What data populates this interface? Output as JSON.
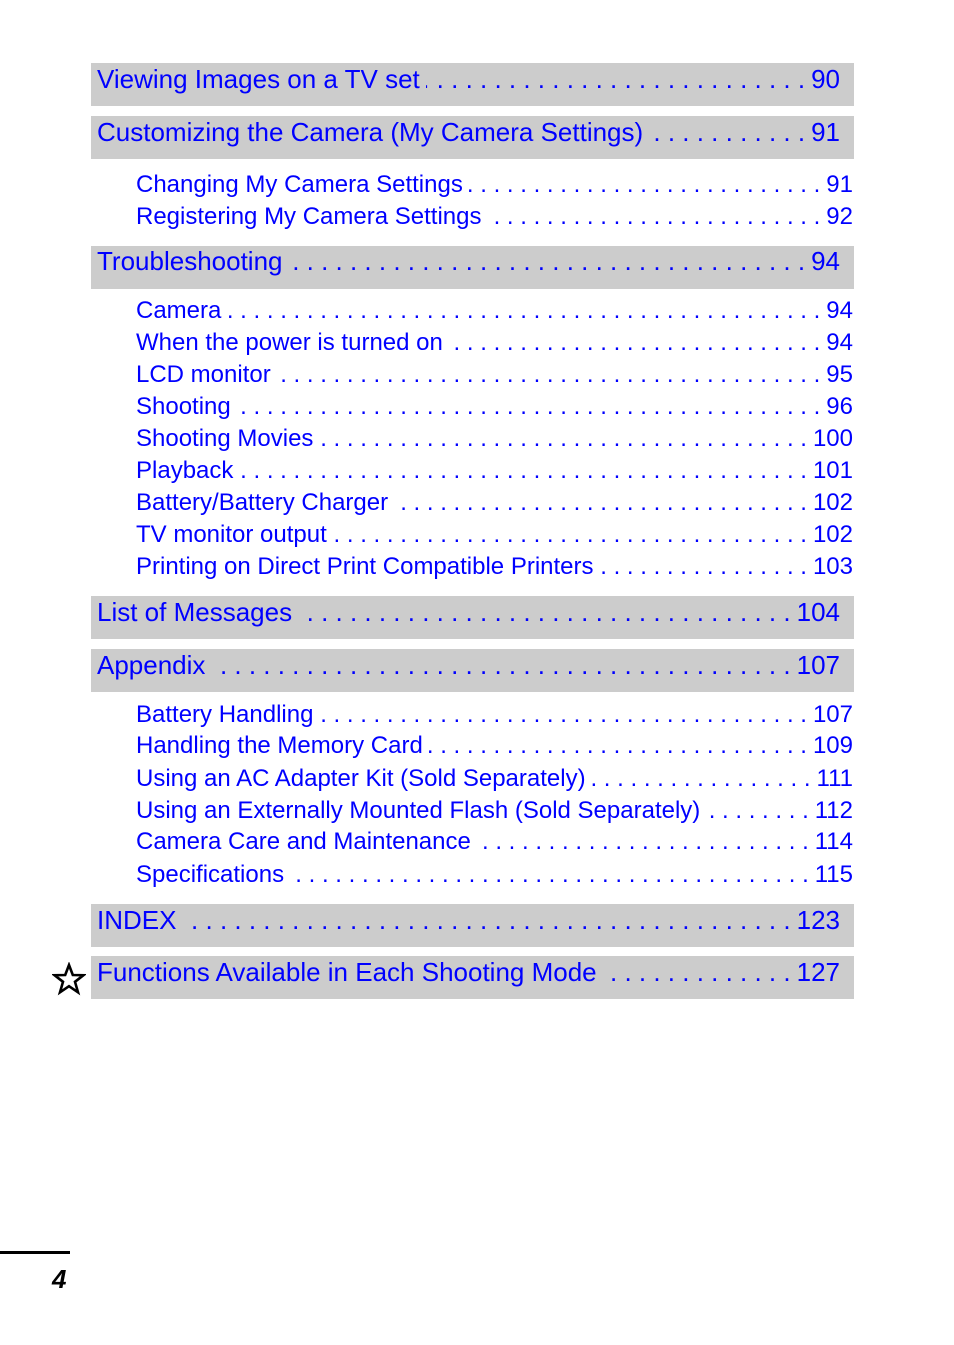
{
  "toc": [
    {
      "type": "section",
      "title": "Viewing Images on a TV set",
      "page": "90"
    },
    {
      "type": "section",
      "title": "Customizing the Camera (My Camera Settings)",
      "page": "91"
    },
    {
      "type": "sub",
      "title": "Changing My Camera Settings",
      "page": "91"
    },
    {
      "type": "sub",
      "title": "Registering My Camera Settings",
      "page": "92"
    },
    {
      "type": "section",
      "title": "Troubleshooting",
      "page": "94"
    },
    {
      "type": "sub",
      "title": "Camera",
      "page": "94"
    },
    {
      "type": "sub",
      "title": "When the power is turned on",
      "page": "94"
    },
    {
      "type": "sub",
      "title": "LCD monitor",
      "page": "95"
    },
    {
      "type": "sub",
      "title": "Shooting",
      "page": "96"
    },
    {
      "type": "sub",
      "title": "Shooting Movies",
      "page": "100"
    },
    {
      "type": "sub",
      "title": "Playback",
      "page": "101"
    },
    {
      "type": "sub",
      "title": "Battery/Battery Charger",
      "page": "102"
    },
    {
      "type": "sub",
      "title": "TV monitor output",
      "page": "102"
    },
    {
      "type": "sub",
      "title": "Printing on Direct Print Compatible Printers",
      "page": "103"
    },
    {
      "type": "section",
      "title": "List of Messages",
      "page": "104"
    },
    {
      "type": "section",
      "title": "Appendix",
      "page": "107"
    },
    {
      "type": "sub",
      "title": "Battery Handling",
      "page": "107"
    },
    {
      "type": "sub",
      "title": "Handling the Memory Card",
      "page": "109"
    },
    {
      "type": "sub",
      "title": "Using an AC Adapter Kit (Sold Separately)",
      "page": "111"
    },
    {
      "type": "sub",
      "title": "Using an Externally Mounted Flash (Sold Separately)",
      "page": "112"
    },
    {
      "type": "sub",
      "title": "Camera Care and Maintenance",
      "page": "114"
    },
    {
      "type": "sub",
      "title": "Specifications",
      "page": "115"
    },
    {
      "type": "section",
      "title": "INDEX",
      "page": "123"
    },
    {
      "type": "section",
      "title": "Functions Available in Each Shooting Mode",
      "page": "127",
      "icon": "star-icon"
    }
  ],
  "colors": {
    "link": "#0000ff",
    "band": "#cccccc",
    "text": "#000000"
  },
  "footer": {
    "page_number": "4"
  }
}
